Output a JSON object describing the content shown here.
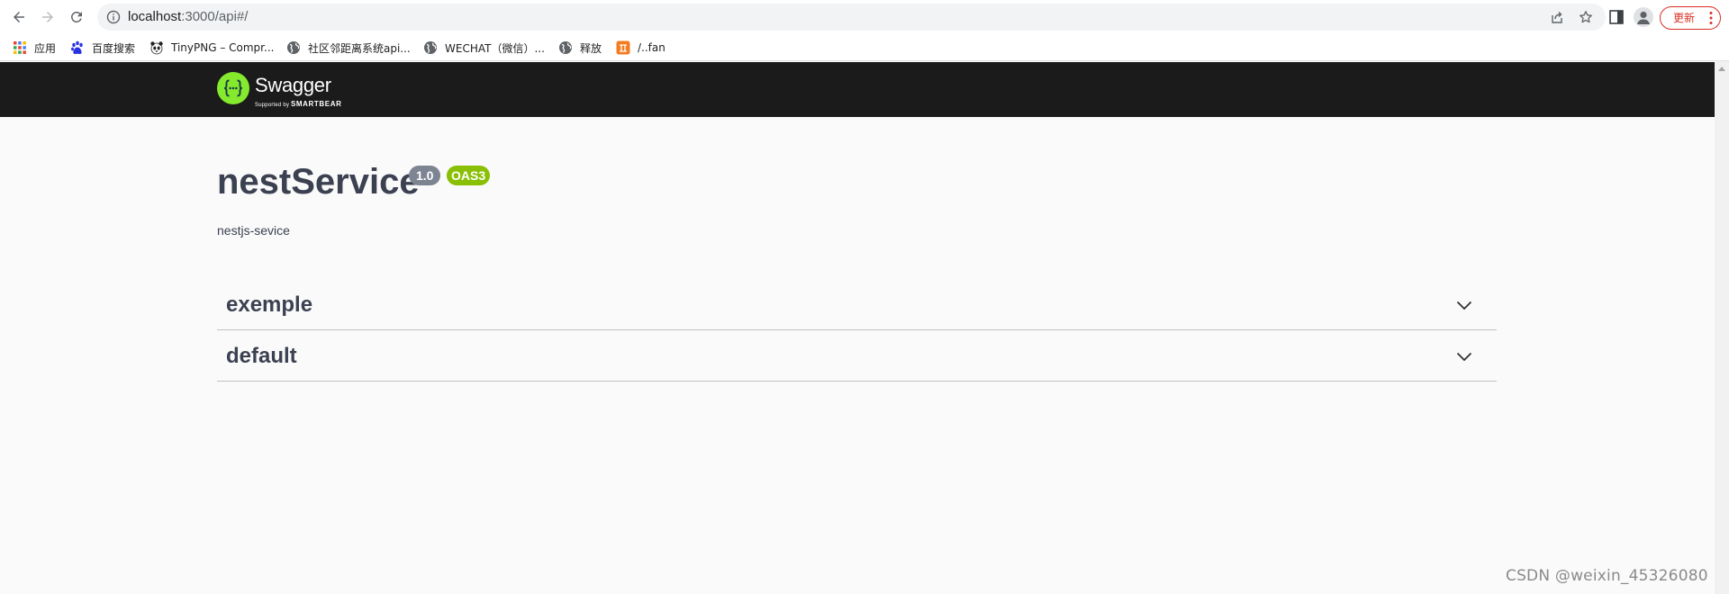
{
  "browser": {
    "url_host": "localhost",
    "url_rest": ":3000/api#/",
    "update_label": "更新",
    "bookmarks": [
      {
        "label": "应用",
        "icon": "apps-grid-icon"
      },
      {
        "label": "百度搜索",
        "icon": "baidu-paw-icon"
      },
      {
        "label": "TinyPNG – Compr...",
        "icon": "panda-icon"
      },
      {
        "label": "社区邻距离系统api...",
        "icon": "globe-icon"
      },
      {
        "label": "WECHAT（微信）...",
        "icon": "globe-icon"
      },
      {
        "label": "释放",
        "icon": "globe-icon"
      },
      {
        "label": "/..fan",
        "icon": "orange-badge-icon"
      }
    ]
  },
  "swagger": {
    "brand": "Swagger",
    "supported_by": "Supported by",
    "smartbear": "SMARTBEAR",
    "logo_color": "#85ea2d",
    "topbar_color": "#1b1b1b"
  },
  "info": {
    "title": "nestService",
    "version": "1.0",
    "oas": "OAS3",
    "description": "nestjs-sevice"
  },
  "tags": [
    {
      "name": "exemple",
      "expanded": false
    },
    {
      "name": "default",
      "expanded": false
    }
  ],
  "watermark": "CSDN @weixin_45326080"
}
